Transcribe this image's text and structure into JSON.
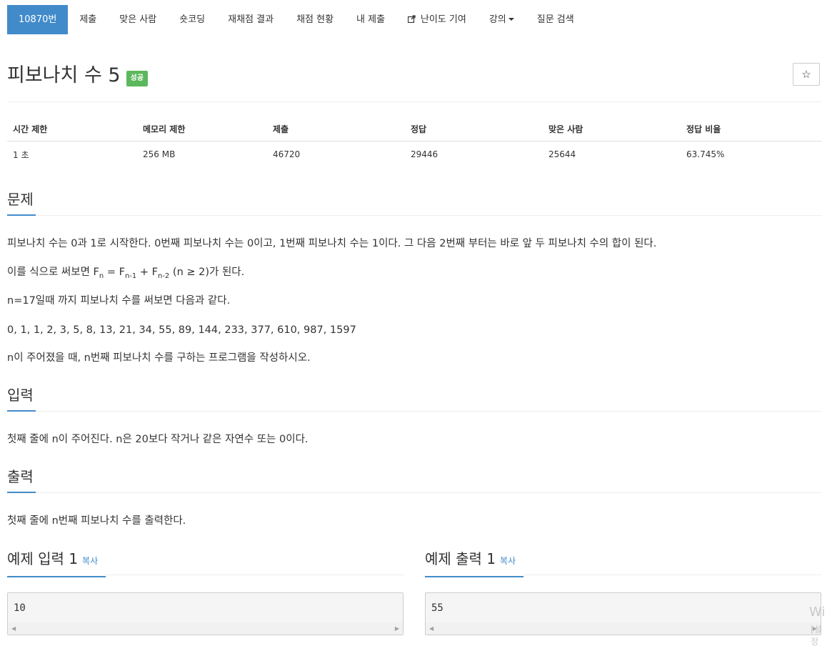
{
  "nav": {
    "items": [
      {
        "label": "10870번",
        "active": true
      },
      {
        "label": "제출"
      },
      {
        "label": "맞은 사람"
      },
      {
        "label": "숏코딩"
      },
      {
        "label": "재채점 결과"
      },
      {
        "label": "채점 현황"
      },
      {
        "label": "내 제출"
      },
      {
        "label": "난이도 기여",
        "icon": "external-link-icon"
      },
      {
        "label": "강의",
        "icon": "caret-down-icon"
      },
      {
        "label": "질문 검색"
      }
    ]
  },
  "problem": {
    "title": "피보나치 수 5",
    "badge": "성공",
    "star": "☆"
  },
  "info_table": {
    "headers": [
      "시간 제한",
      "메모리 제한",
      "제출",
      "정답",
      "맞은 사람",
      "정답 비율"
    ],
    "row": [
      "1 초",
      "256 MB",
      "46720",
      "29446",
      "25644",
      "63.745%"
    ]
  },
  "sections": {
    "problem": {
      "heading": "문제",
      "p1": "피보나치 수는 0과 1로 시작한다. 0번째 피보나치 수는 0이고, 1번째 피보나치 수는 1이다. 그 다음 2번째 부터는 바로 앞 두 피보나치 수의 합이 된다.",
      "p2_prefix": "이를 식으로 써보면 F",
      "p2_sub_n": "n",
      "p2_eq": " = F",
      "p2_sub_n1": "n-1",
      "p2_plus": " + F",
      "p2_sub_n2": "n-2",
      "p2_suffix": " (n ≥ 2)가 된다.",
      "p3": "n=17일때 까지 피보나치 수를 써보면 다음과 같다.",
      "p4": "0, 1, 1, 2, 3, 5, 8, 13, 21, 34, 55, 89, 144, 233, 377, 610, 987, 1597",
      "p5": "n이 주어졌을 때, n번째 피보나치 수를 구하는 프로그램을 작성하시오."
    },
    "input": {
      "heading": "입력",
      "p1": "첫째 줄에 n이 주어진다. n은 20보다 작거나 같은 자연수 또는 0이다."
    },
    "output": {
      "heading": "출력",
      "p1": "첫째 줄에 n번째 피보나치 수를 출력한다."
    }
  },
  "samples": {
    "input": {
      "heading": "예제 입력 1",
      "copy": "복사",
      "value": "10"
    },
    "output": {
      "heading": "예제 출력 1",
      "copy": "복사",
      "value": "55"
    }
  },
  "watermark": {
    "line1": "Wi",
    "line2": "[설정"
  }
}
